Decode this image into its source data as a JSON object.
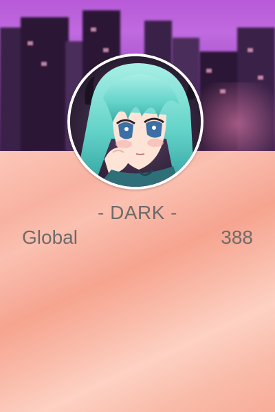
{
  "profile": {
    "username": "- DARK -",
    "avatar_icon": "anime-character-avatar"
  },
  "stats": {
    "label": "Global",
    "value": "388"
  },
  "colors": {
    "banner_purple": "#b45fd6",
    "panel_peach": "#f8b2a1",
    "text_gray": "#6f6a6a",
    "avatar_border": "#ffffff"
  }
}
